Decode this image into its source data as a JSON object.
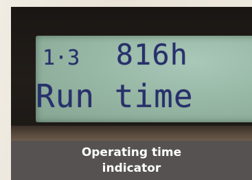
{
  "display": {
    "top_prefix": "1·3",
    "top_value": "816h",
    "bottom_text": "Run time"
  },
  "caption": {
    "line1": "Operating time",
    "line2": "indicator"
  },
  "colors": {
    "lcd_background": "#98b8a6",
    "lcd_text": "#27306b",
    "caption_background": "#555251",
    "caption_text": "#ffffff"
  }
}
